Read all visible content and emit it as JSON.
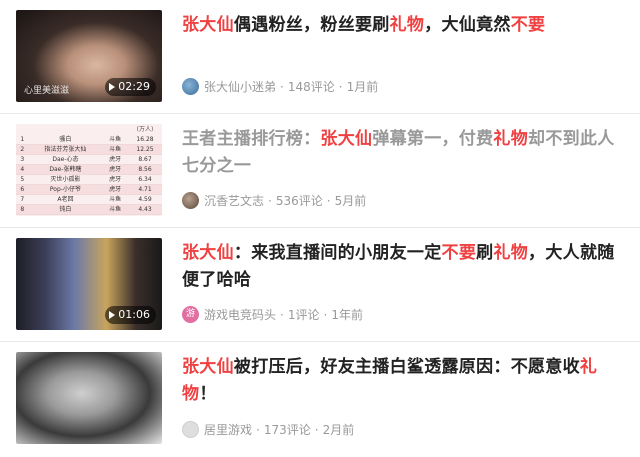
{
  "accent_color": "#f04142",
  "items": [
    {
      "title_parts": [
        {
          "text": "张大仙",
          "hl": true
        },
        {
          "text": "偶遇粉丝，粉丝要刷",
          "hl": false
        },
        {
          "text": "礼物",
          "hl": true
        },
        {
          "text": "，大仙竟然",
          "hl": false
        },
        {
          "text": "不要",
          "hl": true
        }
      ],
      "thumbnail": {
        "duration": "02:29",
        "caption": "心里美滋滋",
        "icon": "play-icon"
      },
      "author_parts": [
        {
          "text": "张大仙",
          "hl": true
        },
        {
          "text": "小迷弟",
          "hl": false
        }
      ],
      "comments": "148评论",
      "time": "1月前"
    },
    {
      "title_parts": [
        {
          "text": "王者主播排行榜：",
          "hl": false
        },
        {
          "text": "张大仙",
          "hl": true
        },
        {
          "text": "弹幕第一，付费",
          "hl": false
        },
        {
          "text": "礼物",
          "hl": true
        },
        {
          "text": "却不到此人七分之一",
          "hl": false
        }
      ],
      "visited": true,
      "thumbnail": {
        "table_headers": [
          "",
          "",
          "",
          "(万人)"
        ],
        "table_rows": [
          [
            "1",
            "骚白",
            "斗鱼",
            "16.28"
          ],
          [
            "2",
            "指法芬芳张大仙",
            "斗鱼",
            "12.25"
          ],
          [
            "3",
            "Dae-心态",
            "虎牙",
            "8.67"
          ],
          [
            "4",
            "Dae-张韩瞎",
            "虎牙",
            "8.56"
          ],
          [
            "5",
            "灭世小孤影",
            "虎牙",
            "6.34"
          ],
          [
            "6",
            "Pop-小仔爷",
            "虎牙",
            "4.71"
          ],
          [
            "7",
            "A老回",
            "斗鱼",
            "4.59"
          ],
          [
            "8",
            "钝白",
            "斗鱼",
            "4.43"
          ]
        ]
      },
      "author_parts": [
        {
          "text": "沉香艺文志",
          "hl": false
        }
      ],
      "comments": "536评论",
      "time": "5月前"
    },
    {
      "title_parts": [
        {
          "text": "张大仙",
          "hl": true
        },
        {
          "text": "：来我直播间的小朋友一定",
          "hl": false
        },
        {
          "text": "不要",
          "hl": true
        },
        {
          "text": "刷",
          "hl": false
        },
        {
          "text": "礼物",
          "hl": true
        },
        {
          "text": "，大人就随便了哈哈",
          "hl": false
        }
      ],
      "thumbnail": {
        "duration": "01:06",
        "icon": "play-icon"
      },
      "author_parts": [
        {
          "text": "游戏电竞码头",
          "hl": false
        }
      ],
      "avatar_text": "游",
      "comments": "1评论",
      "time": "1年前"
    },
    {
      "title_parts": [
        {
          "text": "张大仙",
          "hl": true
        },
        {
          "text": "被打压后，好友主播白鲨透露原因：不愿意收",
          "hl": false
        },
        {
          "text": "礼物",
          "hl": true
        },
        {
          "text": "！",
          "hl": false
        }
      ],
      "author_parts": [
        {
          "text": "居里游戏",
          "hl": false
        }
      ],
      "comments": "173评论",
      "time": "2月前"
    }
  ]
}
